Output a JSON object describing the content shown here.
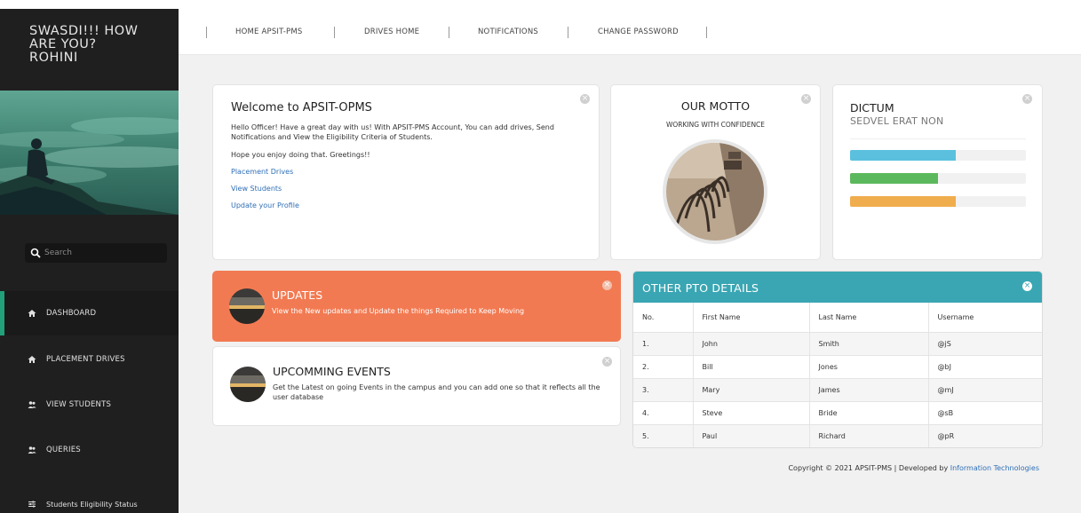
{
  "sidebar": {
    "greeting_line1": "SWASDI!!! HOW",
    "greeting_line2": "ARE YOU?",
    "greeting_line3": "ROHINI",
    "search_placeholder": "Search",
    "items": [
      {
        "label": "DASHBOARD",
        "icon": "home-icon"
      },
      {
        "label": "PLACEMENT DRIVES",
        "icon": "home-icon"
      },
      {
        "label": "VIEW STUDENTS",
        "icon": "users-icon"
      },
      {
        "label": "QUERIES",
        "icon": "users-icon"
      },
      {
        "label": "Students Eligibility Status",
        "icon": "sliders-icon"
      }
    ],
    "accent_color": "#21a07a"
  },
  "topnav": {
    "items": [
      "HOME APSIT-PMS",
      "DRIVES HOME",
      "NOTIFICATIONS",
      "CHANGE PASSWORD"
    ]
  },
  "welcome": {
    "title": "Welcome to APSIT-OPMS",
    "desc": "Hello Officer! Have a great day with us! With APSIT-PMS Account, You can add drives, Send Notifications and View the Eligibility Criteria of Students.",
    "hope": "Hope you enjoy doing that. Greetings!!",
    "links": [
      "Placement Drives",
      "View Students",
      "Update your Profile"
    ]
  },
  "motto": {
    "title": "OUR MOTTO",
    "subtitle": "WORKING WITH CONFIDENCE"
  },
  "dictum": {
    "title": "DICTUM",
    "subtitle": "SEDVEL ERAT NON",
    "bars": [
      {
        "value": 0.6,
        "color": "#5bc0de"
      },
      {
        "value": 0.5,
        "color": "#5cb85c"
      },
      {
        "value": 0.6,
        "color": "#f0ad4e"
      }
    ]
  },
  "updates": {
    "title": "UPDATES",
    "subtitle": "View the New updates and Update the things Required to Keep Moving",
    "color": "#f27a52"
  },
  "events": {
    "title": "UPCOMMING EVENTS",
    "subtitle": "Get the Latest on going Events in the campus and you can add one so that it reflects all the user database"
  },
  "pto": {
    "title": "OTHER PTO DETAILS",
    "color": "#3aa6b3",
    "headers": [
      "No.",
      "First Name",
      "Last Name",
      "Username"
    ],
    "rows": [
      [
        "1.",
        "John",
        "Smith",
        "@jS"
      ],
      [
        "2.",
        "Bill",
        "Jones",
        "@bJ"
      ],
      [
        "3.",
        "Mary",
        "James",
        "@mJ"
      ],
      [
        "4.",
        "Steve",
        "Bride",
        "@sB"
      ],
      [
        "5.",
        "Paul",
        "Richard",
        "@pR"
      ]
    ]
  },
  "footer": {
    "text": "Copyright © 2021 APSIT-PMS | Developed by ",
    "link": "Information Technologies"
  }
}
